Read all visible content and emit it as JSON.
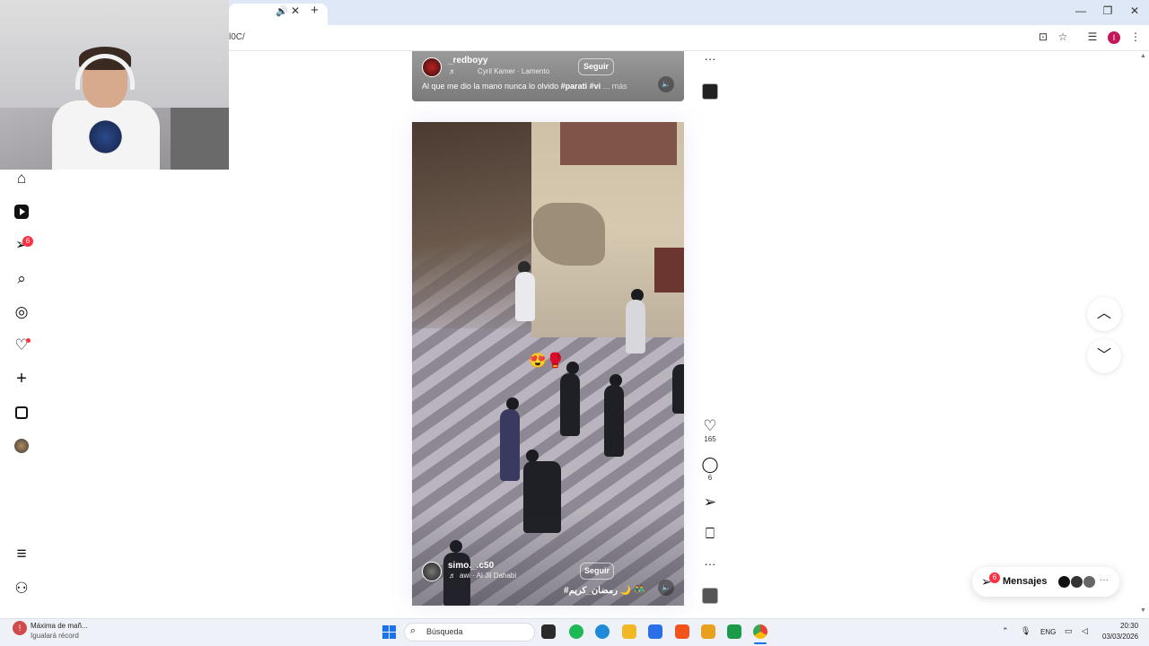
{
  "browser": {
    "tab_audio_icon": "🔊",
    "tab_close_icon": "✕",
    "new_tab_icon": "+",
    "url": "l0C/",
    "window_controls": {
      "minimize": "—",
      "restore": "❐",
      "close": "✕"
    },
    "toolbar_icons": {
      "install": "⊡",
      "bookmark": "☆",
      "media": "☰",
      "profile": "I",
      "menu": "⋮"
    }
  },
  "sidebar": {
    "icons": {
      "home": "⌂",
      "notifications_badge": "6",
      "search": "⌕",
      "explore": "◎",
      "notifications": "♡",
      "create": "+",
      "more": "≡",
      "also_from_meta": "⚇"
    }
  },
  "reel1": {
    "username": "_redboyy",
    "song_note": "♬",
    "song": "Cyril Kamer · Lamento",
    "follow_label": "Seguir",
    "caption_text": "Al que me dio la mano nunca lo olvido ",
    "caption_tags": "#parati #vi",
    "caption_more": " ... más",
    "volume_icon": "🔈",
    "more_icon": "···"
  },
  "reel2": {
    "username": "simo._.c50",
    "song_note": "♬",
    "song": "awi · Al Jil Dahabi",
    "follow_label": "Seguir",
    "caption": "#رمضان_كريم 🌙 👬",
    "emoji_sticker": "😍🥊",
    "volume_icon": "🔈",
    "actions": {
      "like_icon": "♡",
      "like_count": "165",
      "comment_icon": "◯",
      "comment_count": "6",
      "share_icon": "➢",
      "save_icon": "⎕",
      "more_icon": "···"
    }
  },
  "navigation": {
    "up_icon": "︿",
    "down_icon": "﹀"
  },
  "messages": {
    "icon": "➢",
    "badge": "6",
    "label": "Mensajes",
    "more_icon": "···"
  },
  "taskbar": {
    "weather_title": "Máxima de mañ...",
    "weather_sub": "Igualará récord",
    "weather_icon": "!",
    "search_icon": "⌕",
    "search_placeholder": "Búsqueda",
    "tray_chevron": "⌃",
    "language": "ENG",
    "mic_icon": "🎙",
    "clock_time": "20:30",
    "clock_date": "03/03/2026",
    "colors": {
      "spotify": "#1db954",
      "edge": "#1f8ad8",
      "files": "#f2b824",
      "store": "#2a6ee8",
      "brave": "#f0531c",
      "chrome": "#1a73e8"
    }
  }
}
